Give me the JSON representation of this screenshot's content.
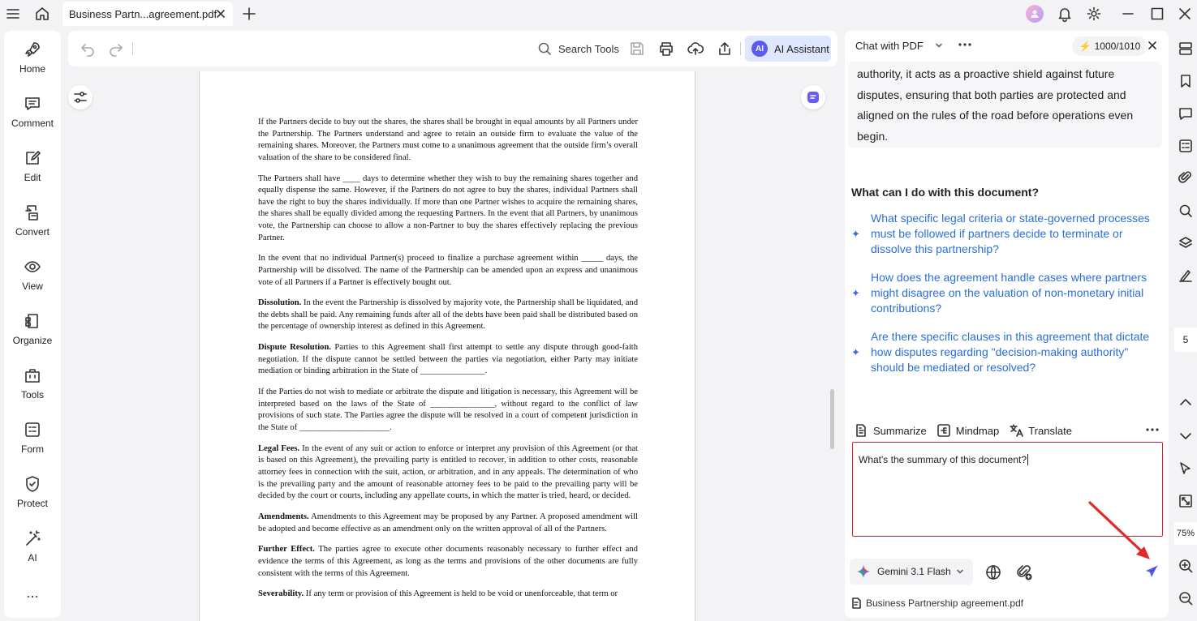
{
  "tab": {
    "title": "Business Partn...agreement.pdf"
  },
  "sidebar": {
    "items": [
      {
        "label": "Home",
        "icon": "rocket-icon"
      },
      {
        "label": "Comment",
        "icon": "comment-icon"
      },
      {
        "label": "Edit",
        "icon": "edit-icon"
      },
      {
        "label": "Convert",
        "icon": "convert-icon"
      },
      {
        "label": "View",
        "icon": "eye-icon"
      },
      {
        "label": "Organize",
        "icon": "organize-icon"
      },
      {
        "label": "Tools",
        "icon": "toolbox-icon"
      },
      {
        "label": "Form",
        "icon": "form-icon"
      },
      {
        "label": "Protect",
        "icon": "shield-icon"
      },
      {
        "label": "AI",
        "icon": "magic-wand-icon"
      }
    ],
    "more": "..."
  },
  "toolbar": {
    "search_label": "Search Tools",
    "ai_badge": "AI",
    "ai_label": "AI Assistant"
  },
  "document": {
    "paragraphs": [
      {
        "heading": "",
        "text": "If the Partners decide to buy out the shares, the shares shall be brought in equal amounts by all Partners under the Partnership. The Partners understand and agree to retain an outside firm to evaluate the value of the remaining shares. Moreover, the Partners must come to a unanimous agreement that the outside firm’s overall valuation of the share to be considered final."
      },
      {
        "heading": "",
        "text": "The Partners shall have ____ days to determine whether they wish to buy the remaining shares together and equally dispense the same. However, if the Partners do not agree to buy the shares, individual Partners shall have the right to buy the shares individually. If more than one Partner wishes to acquire the remaining shares, the shares shall be equally divided among the requesting Partners. In the event that all Partners, by unanimous vote, the Partnership can choose to allow a non-Partner to buy the shares effectively replacing the previous Partner."
      },
      {
        "heading": "",
        "text": "In the event that no individual Partner(s) proceed to finalize a purchase agreement within _____ days, the Partnership will be dissolved. The name of the Partnership can be amended upon an express and unanimous vote of all Partners if a Partner is effectively bought out."
      },
      {
        "heading": "Dissolution.",
        "text": "In the event the Partnership is dissolved by majority vote, the Partnership shall be liquidated, and the debts shall be paid. Any remaining funds after all of the debts have been paid shall be distributed based on the percentage of ownership interest as defined in this Agreement."
      },
      {
        "heading": "Dispute Resolution.",
        "text": "Parties to this Agreement shall first attempt to settle any dispute through good-faith negotiation. If the dispute cannot be settled between the parties via negotiation, either Party may initiate mediation or binding arbitration in the State of _______________."
      },
      {
        "heading": "",
        "text": "If the Parties do not wish to mediate or arbitrate the dispute and litigation is necessary, this Agreement will be interpreted based on the laws of the State of _______________, without regard to the conflict of law provisions of such state. The Parties agree the dispute will be resolved in a court of competent jurisdiction in the State of _____________________."
      },
      {
        "heading": "Legal Fees.",
        "text": "In the event of any suit or action to enforce or interpret any provision of this Agreement (or that is based on this Agreement), the prevailing party is entitled to recover, in addition to other costs, reasonable attorney fees in connection with the suit, action, or arbitration, and in any appeals. The determination of who is the prevailing party and the amount of reasonable attorney fees to be paid to the prevailing party will be decided by the court or courts, including any appellate courts, in which the matter is tried, heard, or decided."
      },
      {
        "heading": "Amendments.",
        "text": "Amendments to this Agreement may be proposed by any Partner. A proposed amendment will be adopted and become effective as an amendment only on the written approval of all of the Partners."
      },
      {
        "heading": "Further Effect.",
        "text": "The parties agree to execute other documents reasonably necessary to further effect and evidence the terms of this Agreement, as long as the terms and provisions of the other documents are fully consistent with the terms of this Agreement."
      },
      {
        "heading": "Severability.",
        "text": "If any term or provision of this Agreement is held to be void or unenforceable, that term or"
      }
    ]
  },
  "chat": {
    "mode": "Chat with PDF",
    "credits": "1000/1010",
    "answer_excerpt": "authority, it acts as a proactive shield against future disputes, ensuring that both parties are protected and aligned on the rules of the road before operations even begin.",
    "suggestions_heading": "What can I do with this document?",
    "suggestions": [
      "What specific legal criteria or state-governed processes must be followed if partners decide to terminate or dissolve this partnership?",
      "How does the agreement handle cases where partners might disagree on the valuation of non-monetary initial contributions?",
      "Are there specific clauses in this agreement that dictate how disputes regarding \"decision-making authority\" should be mediated or resolved?"
    ],
    "actions": {
      "summarize": "Summarize",
      "mindmap": "Mindmap",
      "translate": "Translate"
    },
    "input_value": "What's the summary of this document?",
    "model": "Gemini 3.1 Flash",
    "file_name": "Business Partnership agreement.pdf"
  },
  "rightrail": {
    "page_number": "5",
    "zoom": "75%"
  },
  "colors": {
    "accent": "#5b5bf2",
    "link": "#2b6fd6",
    "highlight_border": "#d8232a"
  }
}
